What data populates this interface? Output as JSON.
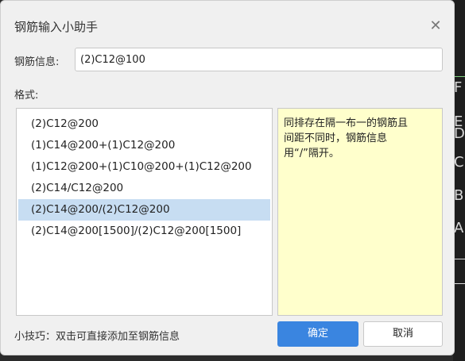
{
  "dialog": {
    "title": "钢筋输入小助手",
    "close_icon": "close-icon",
    "field_label": "钢筋信息:",
    "field_value": "(2)C12@100",
    "format_label": "格式:",
    "formats": [
      "(2)C12@200",
      "(1)C14@200+(1)C12@200",
      "(1)C12@200+(1)C10@200+(1)C12@200",
      "(2)C14/C12@200",
      "(2)C14@200/(2)C12@200",
      "(2)C14@200[1500]/(2)C12@200[1500]"
    ],
    "selected_index": 4,
    "description": "同排存在隔一布一的钢筋且\n间距不同时，钢筋信息\n用“/”隔开。",
    "tip": "小技巧：双击可直接添加至钢筋信息",
    "ok_label": "确定",
    "cancel_label": "取消"
  },
  "background": {
    "letters": [
      "F",
      "E",
      "D",
      "C",
      "B",
      "A"
    ]
  },
  "colors": {
    "accent": "#3a85e0",
    "selection": "#c7ddf2",
    "description_bg": "#ffffcc"
  }
}
